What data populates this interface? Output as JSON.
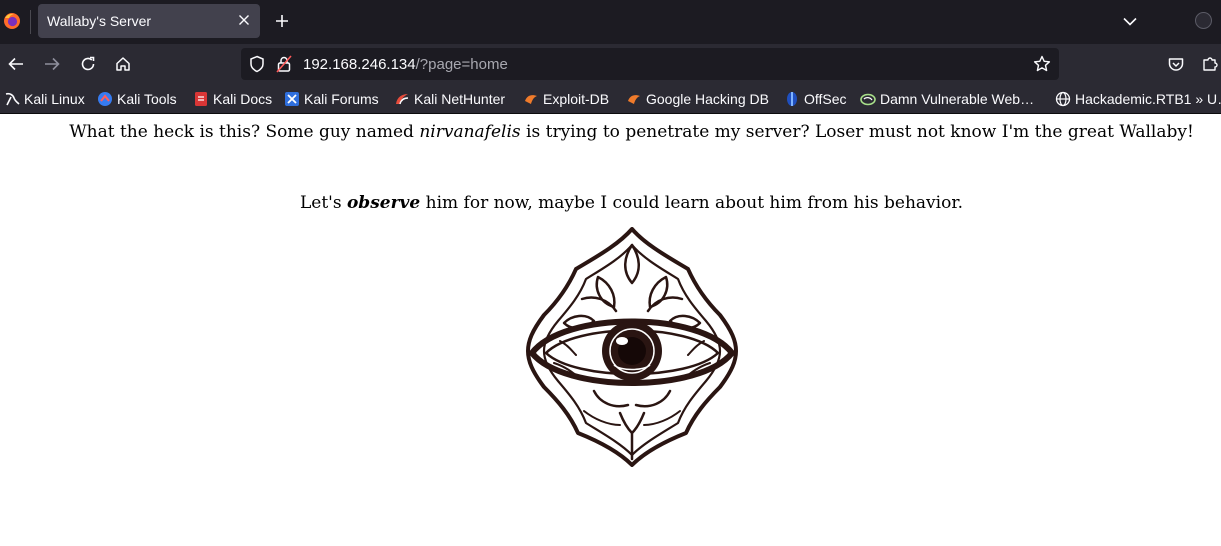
{
  "browser": {
    "tab": {
      "title": "Wallaby's Server"
    },
    "url": {
      "host": "192.168.246.134",
      "path": "/?page=home"
    },
    "bookmarks": [
      {
        "label": "Kali Linux",
        "icon": "kali-dragon-icon"
      },
      {
        "label": "Kali Tools",
        "icon": "kali-tools-icon"
      },
      {
        "label": "Kali Docs",
        "icon": "kali-docs-icon"
      },
      {
        "label": "Kali Forums",
        "icon": "kali-forums-icon"
      },
      {
        "label": "Kali NetHunter",
        "icon": "kali-nethunter-icon"
      },
      {
        "label": "Exploit-DB",
        "icon": "exploit-db-icon"
      },
      {
        "label": "Google Hacking DB",
        "icon": "google-hacking-db-icon"
      },
      {
        "label": "OffSec",
        "icon": "offsec-icon"
      },
      {
        "label": "Damn Vulnerable Web…",
        "icon": "dvwa-icon"
      },
      {
        "label": "Hackademic.RTB1 » U…",
        "icon": "globe-icon"
      }
    ]
  },
  "page": {
    "line1": {
      "before": "What the heck is this? Some guy named ",
      "name": "nirvanafelis",
      "after": " is trying to penetrate my server? Loser must not know I'm the great Wallaby!"
    },
    "line2": {
      "before": "Let's ",
      "emphasis": "observe",
      "after": " him for now, maybe I could learn about him from his behavior."
    },
    "image": {
      "icon": "ornamental-eye-illustration"
    }
  }
}
